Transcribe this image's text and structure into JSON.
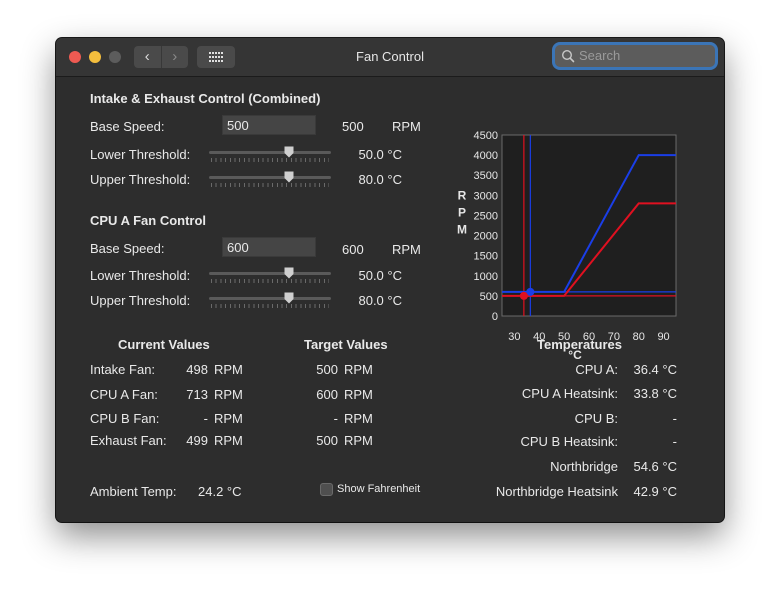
{
  "window": {
    "title": "Fan Control"
  },
  "toolbar": {
    "back_icon": "chevron-left-icon",
    "forward_icon": "chevron-right-icon",
    "grid_icon": "grid-icon"
  },
  "search": {
    "placeholder": "Search",
    "value": ""
  },
  "intake": {
    "heading": "Intake & Exhaust Control (Combined)",
    "base_label": "Base Speed:",
    "base_value": "500",
    "base_display": "500",
    "base_unit": "RPM",
    "lower_label": "Lower Threshold:",
    "lower_value": "50.0 °C",
    "lower_level": 0.67,
    "upper_label": "Upper Threshold:",
    "upper_value": "80.0 °C",
    "upper_level": 0.67
  },
  "cpu_a": {
    "heading": "CPU A Fan Control",
    "base_label": "Base Speed:",
    "base_value": "600",
    "base_display": "600",
    "base_unit": "RPM",
    "lower_label": "Lower Threshold:",
    "lower_value": "50.0 °C",
    "lower_level": 0.67,
    "upper_label": "Upper Threshold:",
    "upper_value": "80.0 °C",
    "upper_level": 0.67
  },
  "current": {
    "heading": "Current Values",
    "rows": [
      {
        "label": "Intake Fan:",
        "value": "498",
        "unit": "RPM"
      },
      {
        "label": "CPU A Fan:",
        "value": "713",
        "unit": "RPM"
      },
      {
        "label": "CPU B Fan:",
        "value": "-",
        "unit": "RPM"
      },
      {
        "label": "Exhaust Fan:",
        "value": "499",
        "unit": "RPM"
      }
    ]
  },
  "target": {
    "heading": "Target Values",
    "rows": [
      {
        "value": "500",
        "unit": "RPM"
      },
      {
        "value": "600",
        "unit": "RPM"
      },
      {
        "value": "-",
        "unit": "RPM"
      },
      {
        "value": "500",
        "unit": "RPM"
      }
    ]
  },
  "temps": {
    "heading": "Temperatures",
    "rows": [
      {
        "label": "CPU A:",
        "value": "36.4 °C"
      },
      {
        "label": "CPU A Heatsink:",
        "value": "33.8 °C"
      },
      {
        "label": "CPU B:",
        "value": "-"
      },
      {
        "label": "CPU B Heatsink:",
        "value": "-"
      },
      {
        "label": "Northbridge",
        "value": "54.6 °C"
      },
      {
        "label": "Northbridge Heatsink",
        "value": "42.9 °C"
      }
    ]
  },
  "ambient": {
    "label": "Ambient Temp:",
    "value": "24.2 °C"
  },
  "fahrenheit": {
    "label": "Show Fahrenheit",
    "checked": false
  },
  "chart_data": {
    "type": "line",
    "ylabel": "RPM",
    "xlabel": "°C",
    "xlim": [
      25,
      95
    ],
    "ylim": [
      0,
      4500
    ],
    "xticks": [
      30,
      40,
      50,
      60,
      70,
      80,
      90
    ],
    "yticks": [
      0,
      500,
      1000,
      1500,
      2000,
      2500,
      3000,
      3500,
      4000,
      4500
    ],
    "series": [
      {
        "color": "#1a3ee8",
        "x": [
          25,
          50,
          80,
          95
        ],
        "y": [
          600,
          600,
          4000,
          4000
        ]
      },
      {
        "color": "#e01020",
        "x": [
          25,
          50,
          80,
          95
        ],
        "y": [
          500,
          500,
          2800,
          2800
        ]
      }
    ],
    "markers": [
      {
        "color": "#1a3ee8",
        "x": 36.4,
        "y": 600
      },
      {
        "color": "#e01020",
        "x": 33.8,
        "y": 500
      }
    ]
  }
}
